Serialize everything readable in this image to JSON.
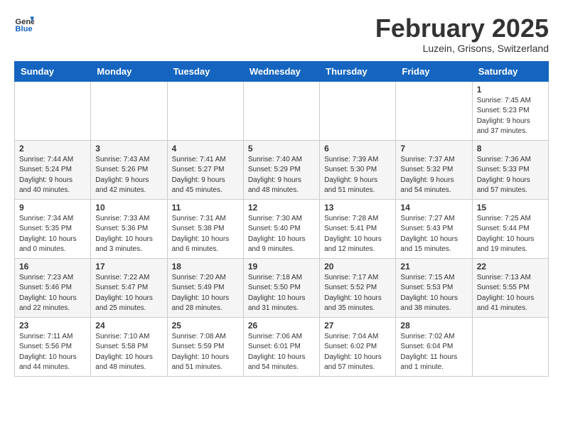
{
  "header": {
    "logo_general": "General",
    "logo_blue": "Blue",
    "month_title": "February 2025",
    "location": "Luzein, Grisons, Switzerland"
  },
  "weekdays": [
    "Sunday",
    "Monday",
    "Tuesday",
    "Wednesday",
    "Thursday",
    "Friday",
    "Saturday"
  ],
  "weeks": [
    [
      {
        "day": "",
        "info": ""
      },
      {
        "day": "",
        "info": ""
      },
      {
        "day": "",
        "info": ""
      },
      {
        "day": "",
        "info": ""
      },
      {
        "day": "",
        "info": ""
      },
      {
        "day": "",
        "info": ""
      },
      {
        "day": "1",
        "info": "Sunrise: 7:45 AM\nSunset: 5:23 PM\nDaylight: 9 hours\nand 37 minutes."
      }
    ],
    [
      {
        "day": "2",
        "info": "Sunrise: 7:44 AM\nSunset: 5:24 PM\nDaylight: 9 hours\nand 40 minutes."
      },
      {
        "day": "3",
        "info": "Sunrise: 7:43 AM\nSunset: 5:26 PM\nDaylight: 9 hours\nand 42 minutes."
      },
      {
        "day": "4",
        "info": "Sunrise: 7:41 AM\nSunset: 5:27 PM\nDaylight: 9 hours\nand 45 minutes."
      },
      {
        "day": "5",
        "info": "Sunrise: 7:40 AM\nSunset: 5:29 PM\nDaylight: 9 hours\nand 48 minutes."
      },
      {
        "day": "6",
        "info": "Sunrise: 7:39 AM\nSunset: 5:30 PM\nDaylight: 9 hours\nand 51 minutes."
      },
      {
        "day": "7",
        "info": "Sunrise: 7:37 AM\nSunset: 5:32 PM\nDaylight: 9 hours\nand 54 minutes."
      },
      {
        "day": "8",
        "info": "Sunrise: 7:36 AM\nSunset: 5:33 PM\nDaylight: 9 hours\nand 57 minutes."
      }
    ],
    [
      {
        "day": "9",
        "info": "Sunrise: 7:34 AM\nSunset: 5:35 PM\nDaylight: 10 hours\nand 0 minutes."
      },
      {
        "day": "10",
        "info": "Sunrise: 7:33 AM\nSunset: 5:36 PM\nDaylight: 10 hours\nand 3 minutes."
      },
      {
        "day": "11",
        "info": "Sunrise: 7:31 AM\nSunset: 5:38 PM\nDaylight: 10 hours\nand 6 minutes."
      },
      {
        "day": "12",
        "info": "Sunrise: 7:30 AM\nSunset: 5:40 PM\nDaylight: 10 hours\nand 9 minutes."
      },
      {
        "day": "13",
        "info": "Sunrise: 7:28 AM\nSunset: 5:41 PM\nDaylight: 10 hours\nand 12 minutes."
      },
      {
        "day": "14",
        "info": "Sunrise: 7:27 AM\nSunset: 5:43 PM\nDaylight: 10 hours\nand 15 minutes."
      },
      {
        "day": "15",
        "info": "Sunrise: 7:25 AM\nSunset: 5:44 PM\nDaylight: 10 hours\nand 19 minutes."
      }
    ],
    [
      {
        "day": "16",
        "info": "Sunrise: 7:23 AM\nSunset: 5:46 PM\nDaylight: 10 hours\nand 22 minutes."
      },
      {
        "day": "17",
        "info": "Sunrise: 7:22 AM\nSunset: 5:47 PM\nDaylight: 10 hours\nand 25 minutes."
      },
      {
        "day": "18",
        "info": "Sunrise: 7:20 AM\nSunset: 5:49 PM\nDaylight: 10 hours\nand 28 minutes."
      },
      {
        "day": "19",
        "info": "Sunrise: 7:18 AM\nSunset: 5:50 PM\nDaylight: 10 hours\nand 31 minutes."
      },
      {
        "day": "20",
        "info": "Sunrise: 7:17 AM\nSunset: 5:52 PM\nDaylight: 10 hours\nand 35 minutes."
      },
      {
        "day": "21",
        "info": "Sunrise: 7:15 AM\nSunset: 5:53 PM\nDaylight: 10 hours\nand 38 minutes."
      },
      {
        "day": "22",
        "info": "Sunrise: 7:13 AM\nSunset: 5:55 PM\nDaylight: 10 hours\nand 41 minutes."
      }
    ],
    [
      {
        "day": "23",
        "info": "Sunrise: 7:11 AM\nSunset: 5:56 PM\nDaylight: 10 hours\nand 44 minutes."
      },
      {
        "day": "24",
        "info": "Sunrise: 7:10 AM\nSunset: 5:58 PM\nDaylight: 10 hours\nand 48 minutes."
      },
      {
        "day": "25",
        "info": "Sunrise: 7:08 AM\nSunset: 5:59 PM\nDaylight: 10 hours\nand 51 minutes."
      },
      {
        "day": "26",
        "info": "Sunrise: 7:06 AM\nSunset: 6:01 PM\nDaylight: 10 hours\nand 54 minutes."
      },
      {
        "day": "27",
        "info": "Sunrise: 7:04 AM\nSunset: 6:02 PM\nDaylight: 10 hours\nand 57 minutes."
      },
      {
        "day": "28",
        "info": "Sunrise: 7:02 AM\nSunset: 6:04 PM\nDaylight: 11 hours\nand 1 minute."
      },
      {
        "day": "",
        "info": ""
      }
    ]
  ]
}
